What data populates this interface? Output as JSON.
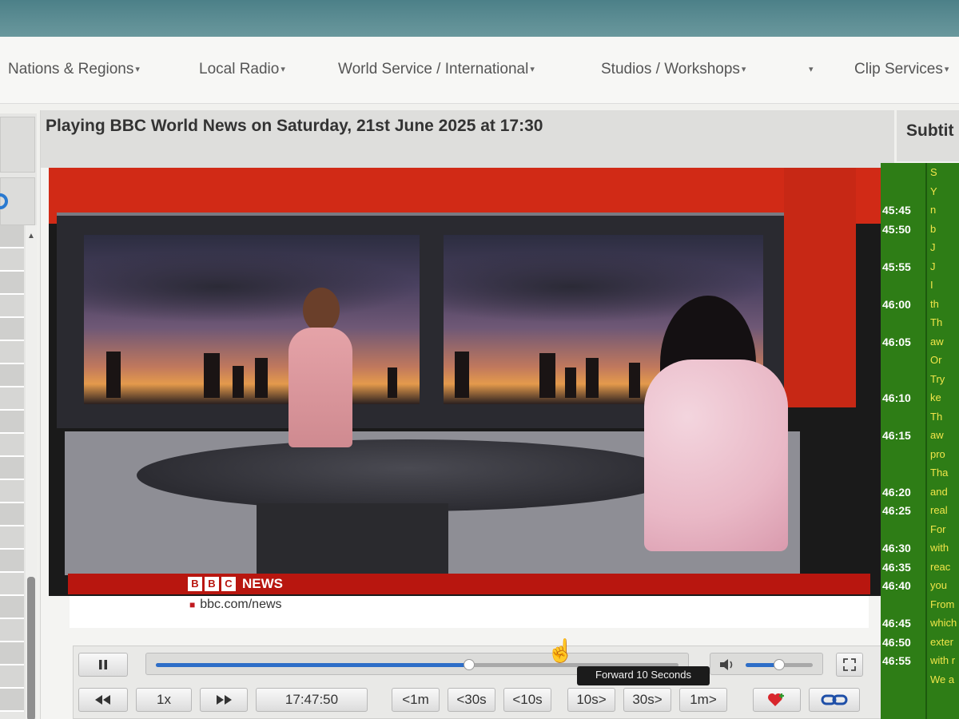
{
  "nav": {
    "items": [
      {
        "label": "Nations & Regions",
        "caret": "▾"
      },
      {
        "label": "Local Radio",
        "caret": "▾"
      },
      {
        "label": "World Service / International",
        "caret": "▾"
      },
      {
        "label": "Studios / Workshops",
        "caret": "▾"
      },
      {
        "label": "",
        "caret": "▾"
      },
      {
        "label": "Clip Services",
        "caret": "▾"
      }
    ]
  },
  "player": {
    "title": "Playing BBC World News on Saturday, 21st June 2025 at 17:30",
    "channel_brand": {
      "letters": [
        "B",
        "B",
        "C"
      ],
      "word": "NEWS"
    },
    "url_text": "bbc.com/news",
    "progress_fraction": 0.6,
    "volume_fraction": 0.5
  },
  "controls": {
    "pause_icon": "pause-icon",
    "rewind_icon": "rewind-icon",
    "fast_forward_icon": "fast-forward-icon",
    "speed": "1x",
    "time": "17:47:50",
    "jump_buttons": [
      "<1m",
      "<30s",
      "<10s",
      "10s>",
      "30s>",
      "1m>"
    ],
    "favourite_icon": "heart-plus-icon",
    "link_icon": "link-icon",
    "volume_icon": "speaker-icon",
    "fullscreen_icon": "fullscreen-icon",
    "tooltip": "Forward 10 Seconds"
  },
  "subtitles": {
    "header": "Subtit",
    "rows": [
      {
        "time": "",
        "text": "S"
      },
      {
        "time": "",
        "text": "Y"
      },
      {
        "time": "45:45",
        "text": "n"
      },
      {
        "time": "45:50",
        "text": "b"
      },
      {
        "time": "",
        "text": "J"
      },
      {
        "time": "45:55",
        "text": "J"
      },
      {
        "time": "",
        "text": "I"
      },
      {
        "time": "46:00",
        "text": "th"
      },
      {
        "time": "",
        "text": "Th"
      },
      {
        "time": "46:05",
        "text": "aw"
      },
      {
        "time": "",
        "text": "Or"
      },
      {
        "time": "",
        "text": "Try"
      },
      {
        "time": "46:10",
        "text": "ke"
      },
      {
        "time": "",
        "text": "Th"
      },
      {
        "time": "46:15",
        "text": "aw"
      },
      {
        "time": "",
        "text": "pro"
      },
      {
        "time": "",
        "text": "Tha"
      },
      {
        "time": "46:20",
        "text": "and"
      },
      {
        "time": "46:25",
        "text": "real"
      },
      {
        "time": "",
        "text": "For"
      },
      {
        "time": "46:30",
        "text": "with"
      },
      {
        "time": "46:35",
        "text": "reac"
      },
      {
        "time": "46:40",
        "text": "you"
      },
      {
        "time": "",
        "text": "From"
      },
      {
        "time": "46:45",
        "text": "which"
      },
      {
        "time": "46:50",
        "text": "exter"
      },
      {
        "time": "46:55",
        "text": "with r"
      },
      {
        "time": "",
        "text": "We a"
      }
    ]
  }
}
